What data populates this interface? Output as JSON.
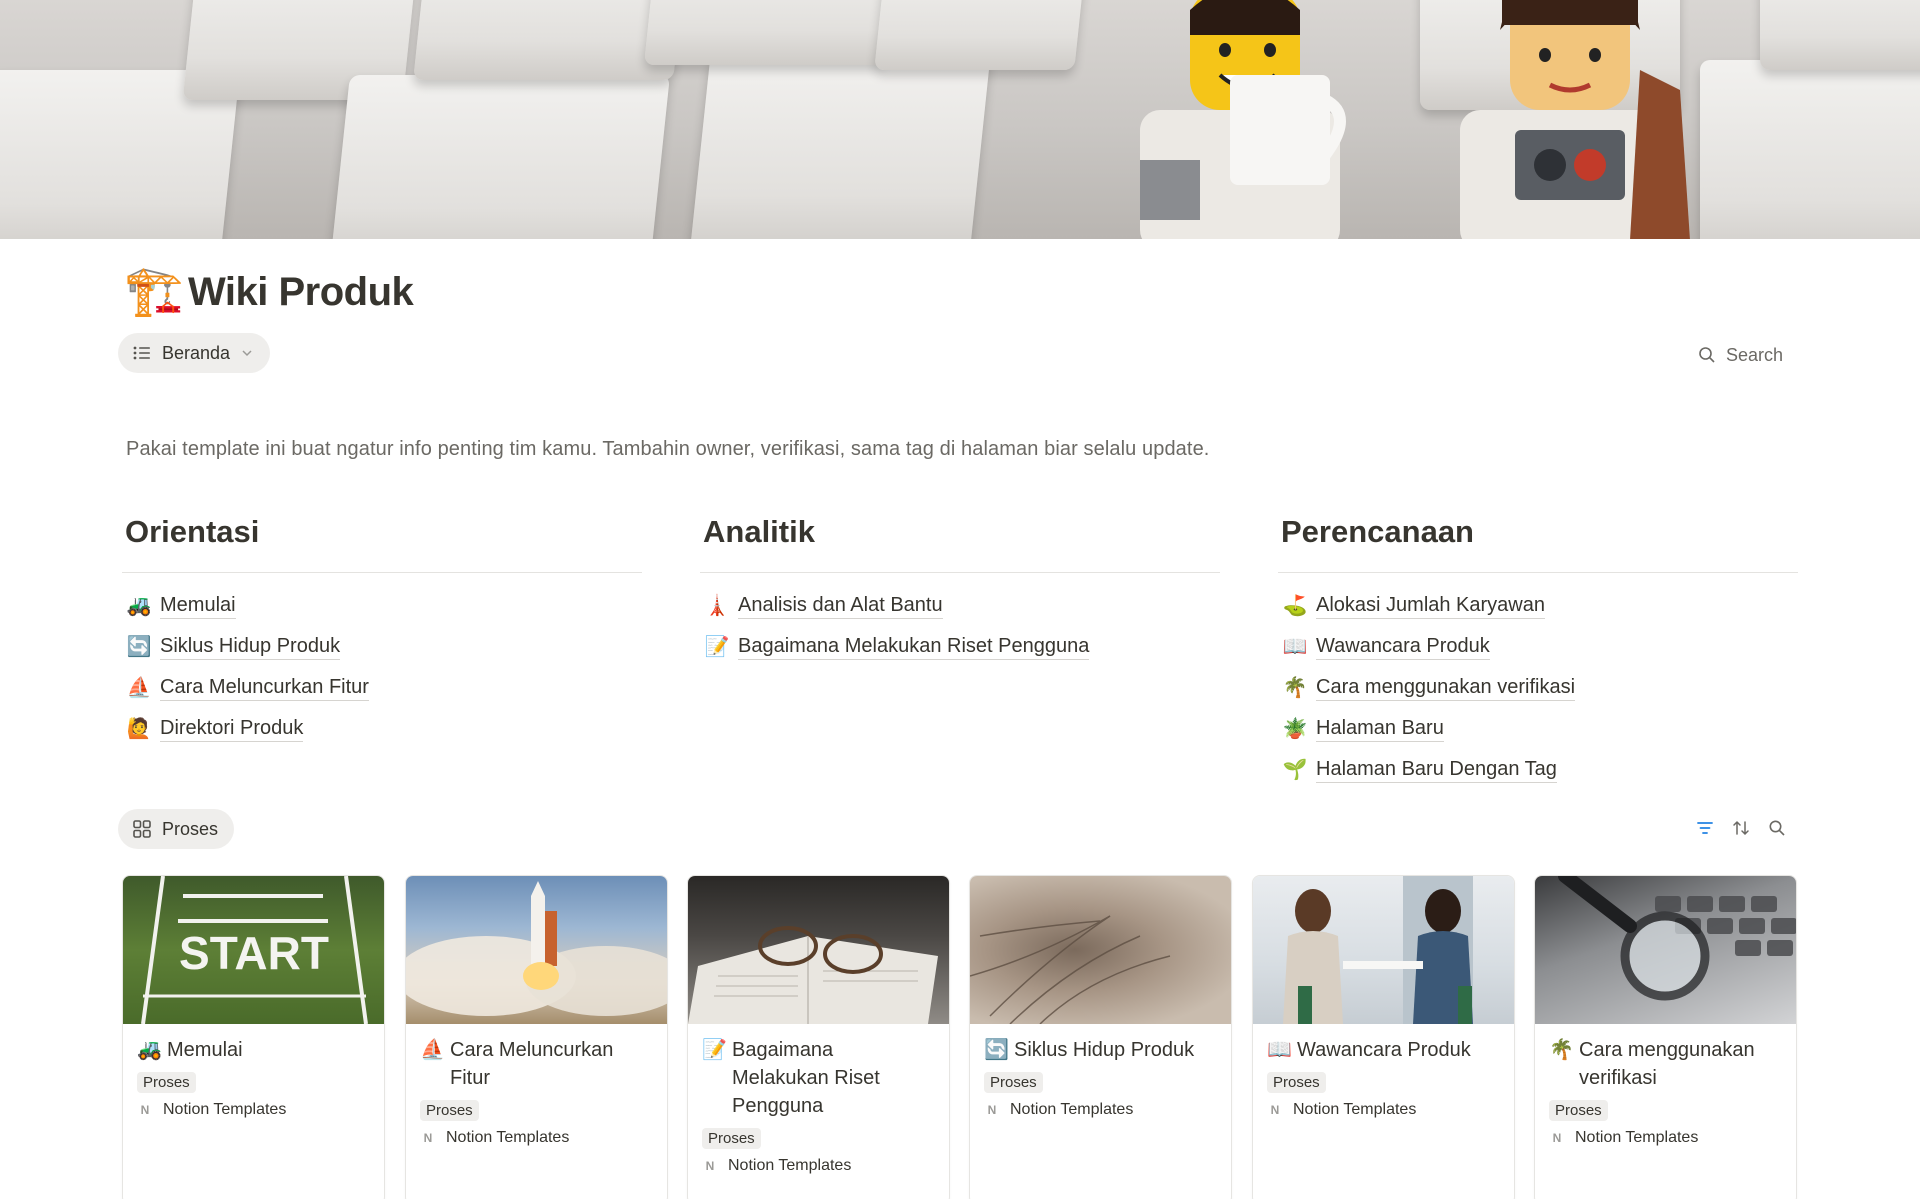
{
  "page": {
    "title_emoji": "🏗️",
    "title": "Wiki Produk",
    "view_label": "Beranda",
    "search_label": "Search",
    "intro": "Pakai template ini buat ngatur info penting tim kamu. Tambahin owner, verifikasi, sama tag di halaman biar selalu update."
  },
  "sections": [
    {
      "title": "Orientasi",
      "items": [
        {
          "emoji": "🚜",
          "label": "Memulai"
        },
        {
          "emoji": "🔄",
          "label": "Siklus Hidup Produk"
        },
        {
          "emoji": "⛵",
          "label": "Cara Meluncurkan Fitur"
        },
        {
          "emoji": "🙋",
          "label": "Direktori Produk"
        }
      ]
    },
    {
      "title": "Analitik",
      "items": [
        {
          "emoji": "🗼",
          "label": "Analisis dan Alat Bantu"
        },
        {
          "emoji": "📝",
          "label": "Bagaimana Melakukan Riset Pengguna"
        }
      ]
    },
    {
      "title": "Perencanaan",
      "items": [
        {
          "emoji": "⛳",
          "label": "Alokasi Jumlah Karyawan"
        },
        {
          "emoji": "📖",
          "label": "Wawancara Produk"
        },
        {
          "emoji": "🌴",
          "label": "Cara menggunakan verifikasi"
        },
        {
          "emoji": "🪴",
          "label": "Halaman Baru"
        },
        {
          "emoji": "🌱",
          "label": "Halaman Baru Dengan Tag"
        }
      ]
    }
  ],
  "database": {
    "tab_label": "Proses",
    "tools": [
      "filter-icon",
      "sort-icon",
      "search-icon"
    ],
    "cards": [
      {
        "emoji": "🚜",
        "title": "Memulai",
        "tag": "Proses",
        "source": "Notion Templates",
        "thumb_text": "START"
      },
      {
        "emoji": "⛵",
        "title": "Cara Meluncurkan Fitur",
        "tag": "Proses",
        "source": "Notion Templates"
      },
      {
        "emoji": "📝",
        "title": "Bagaimana Melakukan Riset Pengguna",
        "tag": "Proses",
        "source": "Notion Templates"
      },
      {
        "emoji": "🔄",
        "title": "Siklus Hidup Produk",
        "tag": "Proses",
        "source": "Notion Templates"
      },
      {
        "emoji": "📖",
        "title": "Wawancara Produk",
        "tag": "Proses",
        "source": "Notion Templates"
      },
      {
        "emoji": "🌴",
        "title": "Cara menggunakan verifikasi",
        "tag": "Proses",
        "source": "Notion Templates"
      }
    ]
  },
  "colors": {
    "text": "#37352f",
    "muted": "#6b6964",
    "pill_bg": "#efeeec",
    "accent_blue": "#2383e2"
  }
}
